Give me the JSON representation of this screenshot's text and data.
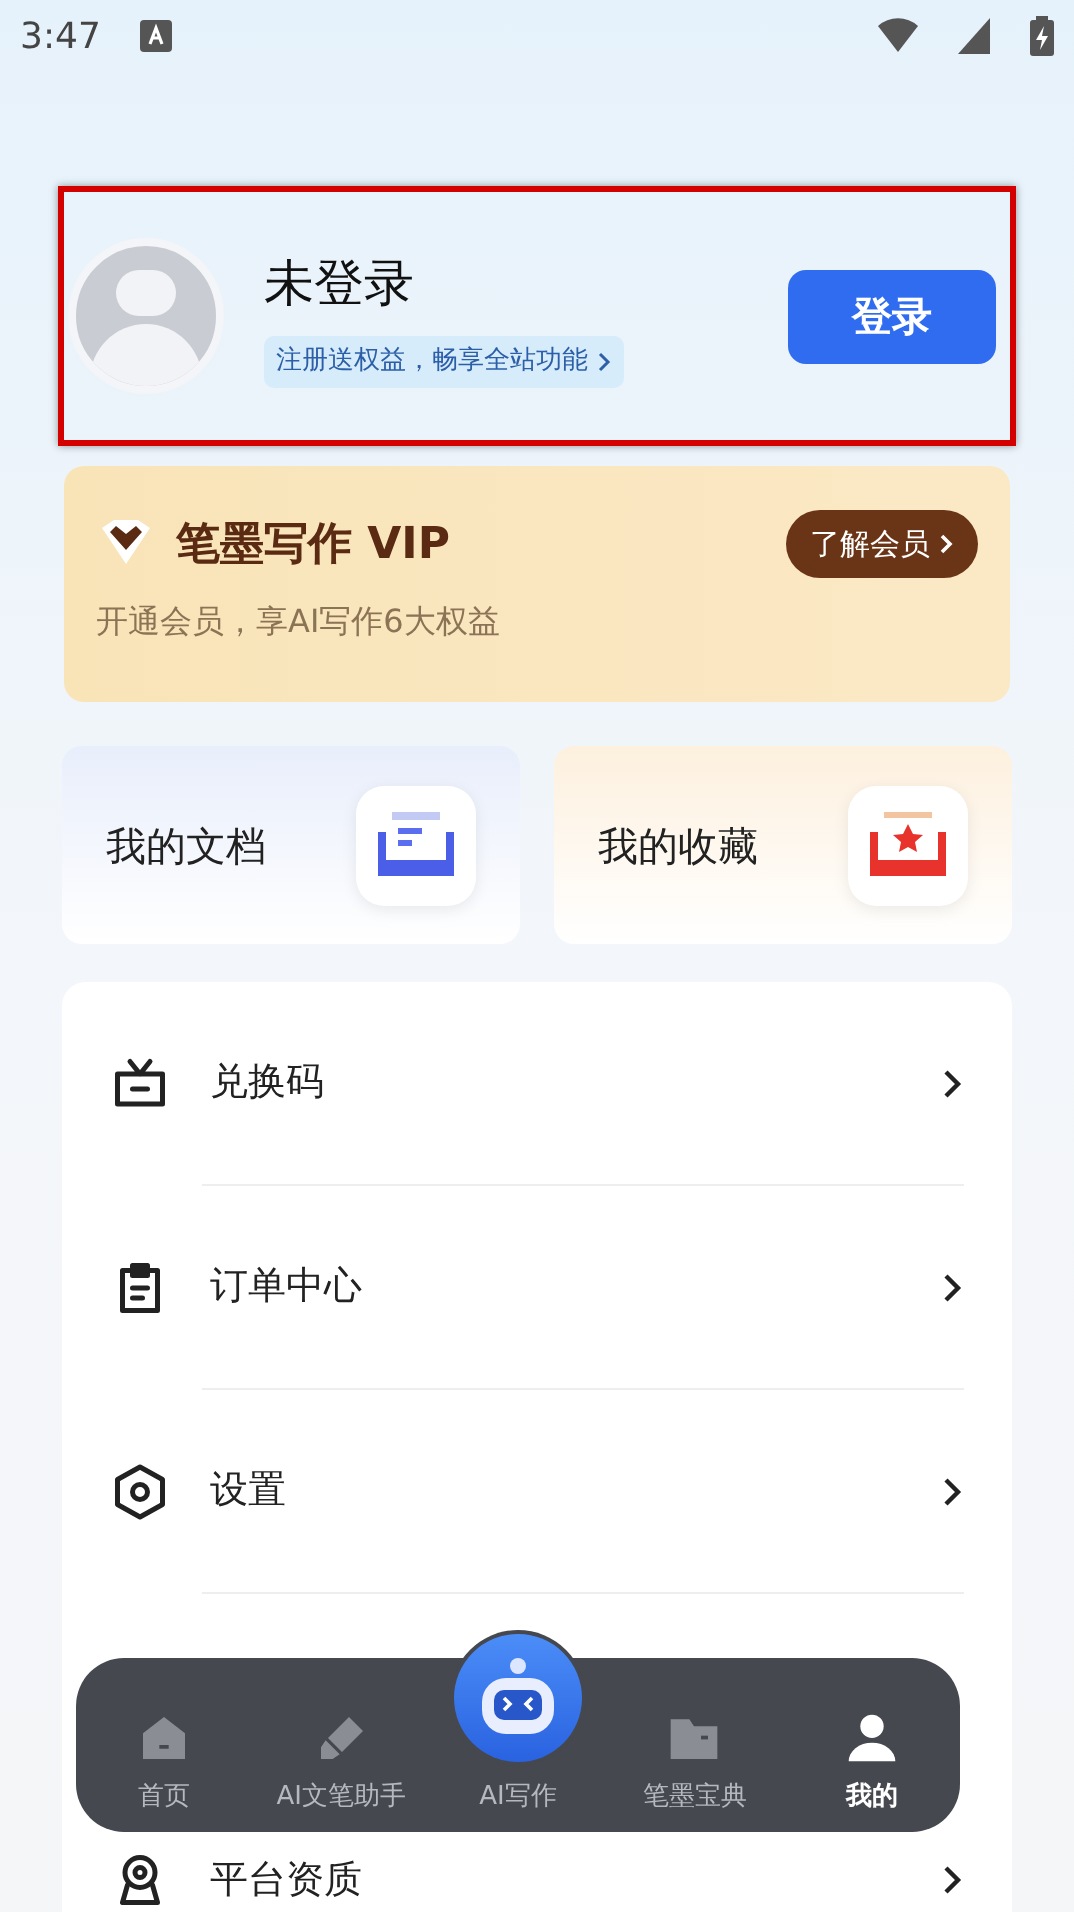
{
  "status_bar": {
    "time": "3:47"
  },
  "profile": {
    "name": "未登录",
    "promo": "注册送权益，畅享全站功能",
    "login_button": "登录",
    "highlighted": true
  },
  "vip": {
    "title": "笔墨写作 VIP",
    "subtitle": "开通会员，享AI写作6大权益",
    "button": "了解会员"
  },
  "quick_cards": [
    {
      "label": "我的文档",
      "kind": "docs"
    },
    {
      "label": "我的收藏",
      "kind": "favorites"
    }
  ],
  "menu": [
    {
      "label": "兑换码",
      "kind": "gift"
    },
    {
      "label": "订单中心",
      "kind": "clipboard"
    },
    {
      "label": "设置",
      "kind": "settings"
    },
    {
      "label": "平台资质",
      "kind": "badge"
    }
  ],
  "tab_bar": [
    {
      "label": "首页",
      "kind": "home",
      "selected": false
    },
    {
      "label": "AI文笔助手",
      "kind": "pen",
      "selected": false
    },
    {
      "label": "AI写作",
      "kind": "robot",
      "selected": false
    },
    {
      "label": "笔墨宝典",
      "kind": "folder",
      "selected": false
    },
    {
      "label": "我的",
      "kind": "person",
      "selected": true
    }
  ]
}
